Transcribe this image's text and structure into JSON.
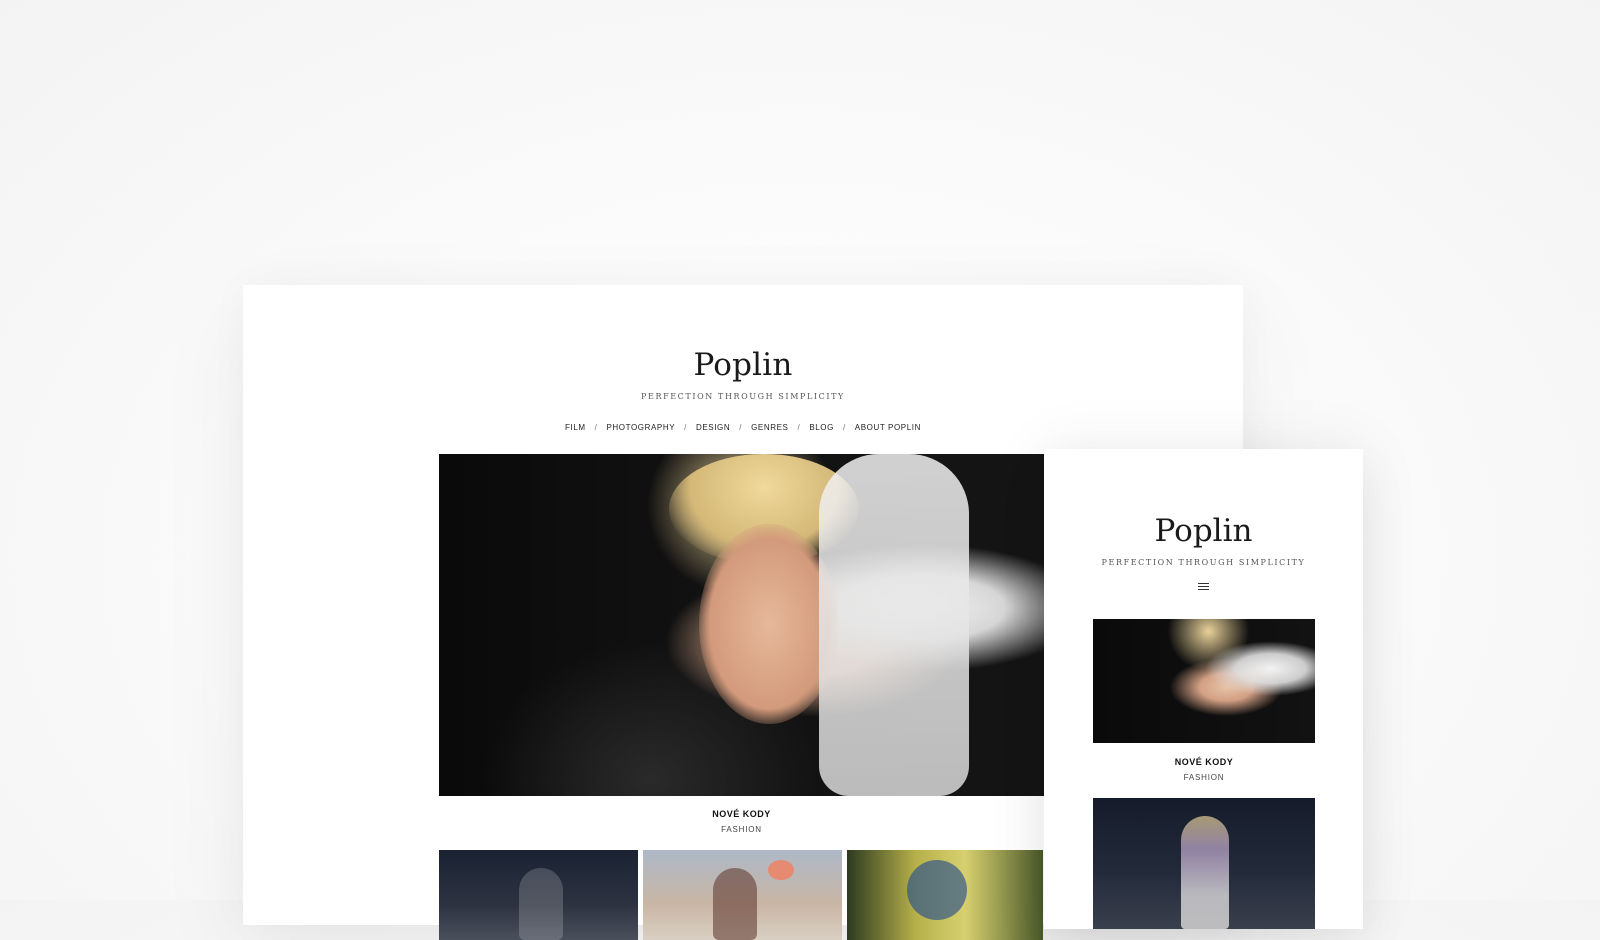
{
  "desktop": {
    "site_title": "Poplin",
    "tagline": "PERFECTION THROUGH SIMPLICITY",
    "nav": [
      "FILM",
      "PHOTOGRAPHY",
      "DESIGN",
      "GENRES",
      "BLOG",
      "ABOUT POPLIN"
    ],
    "nav_separator": "/",
    "featured": {
      "title": "NOVÉ KODY",
      "category": "FASHION"
    }
  },
  "mobile": {
    "site_title": "Poplin",
    "tagline": "PERFECTION THROUGH SIMPLICITY",
    "menu_icon": "hamburger-menu-icon",
    "featured": {
      "title": "NOVÉ KODY",
      "category": "FASHION"
    }
  }
}
